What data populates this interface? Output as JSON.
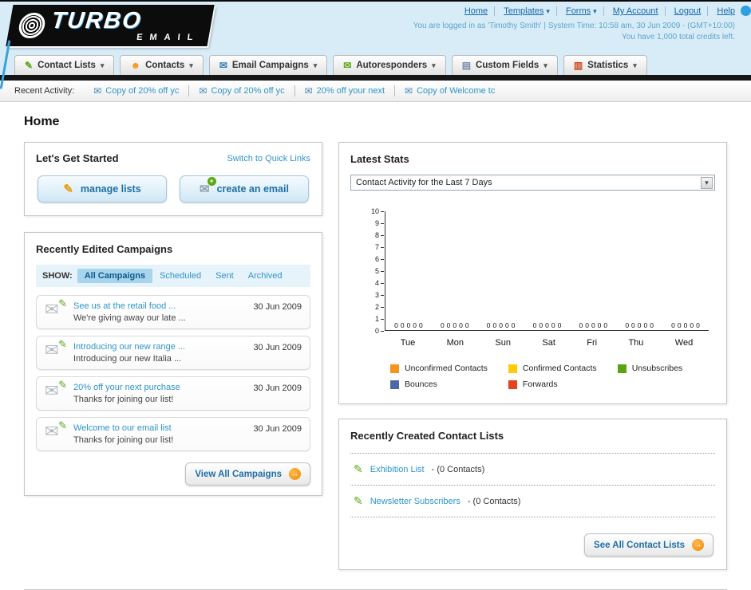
{
  "icons": {
    "dropdown_arrow": "▾",
    "envelope": "✉",
    "pencil": "✎",
    "arrow_right": "→",
    "plus": "+"
  },
  "header": {
    "brand_top": "TURBO",
    "brand_bottom": "EMAIL",
    "links": [
      {
        "label": "Home"
      },
      {
        "label": "Templates"
      },
      {
        "label": "Forms"
      },
      {
        "label": "My Account"
      },
      {
        "label": "Logout"
      },
      {
        "label": "Help"
      }
    ],
    "login_info": "You are logged in as 'Timothy Smith' | System Time: 10:58 am, 30 Jun 2009 - (GMT+10:00)",
    "credits": "You have 1,000 total credits left."
  },
  "nav": {
    "items": [
      {
        "label": "Contact Lists",
        "icon": "✎"
      },
      {
        "label": "Contacts",
        "icon": "☻"
      },
      {
        "label": "Email Campaigns",
        "icon": "✉"
      },
      {
        "label": "Autoresponders",
        "icon": "✉"
      },
      {
        "label": "Custom Fields",
        "icon": "▤"
      },
      {
        "label": "Statistics",
        "icon": "▥"
      }
    ]
  },
  "recent_activity": {
    "label": "Recent Activity:",
    "items": [
      "Copy of 20% off yc",
      "Copy of 20% off yc",
      "20% off your next",
      "Copy of Welcome tc"
    ]
  },
  "page": {
    "title": "Home"
  },
  "get_started": {
    "title": "Let's Get Started",
    "switch_link": "Switch to Quick Links",
    "manage_lists_label": "manage lists",
    "create_email_label": "create an email"
  },
  "campaigns": {
    "title": "Recently Edited Campaigns",
    "show_label": "SHOW:",
    "tabs": [
      "All Campaigns",
      "Scheduled",
      "Sent",
      "Archived"
    ],
    "active_tab": "All Campaigns",
    "items": [
      {
        "title": "See us at the retail food ...",
        "subtitle": "We're giving away our late ...",
        "date": "30 Jun 2009"
      },
      {
        "title": "Introducing our new range ...",
        "subtitle": "Introducing our new Italia ...",
        "date": "30 Jun 2009"
      },
      {
        "title": "20% off your next purchase",
        "subtitle": "Thanks for joining our list!",
        "date": "30 Jun 2009"
      },
      {
        "title": "Welcome to our email list",
        "subtitle": "Thanks for joining our list!",
        "date": "30 Jun 2009"
      }
    ],
    "view_all_label": "View All Campaigns"
  },
  "stats": {
    "title": "Latest Stats",
    "dropdown_value": "Contact Activity for the Last 7 Days",
    "chart_data": {
      "type": "bar",
      "title": "Contact Activity for the Last 7 Days",
      "categories": [
        "Tue",
        "Mon",
        "Sun",
        "Sat",
        "Fri",
        "Thu",
        "Wed"
      ],
      "series": [
        {
          "name": "Unconfirmed Contacts",
          "color": "#f7941d",
          "values": [
            0,
            0,
            0,
            0,
            0,
            0,
            0
          ]
        },
        {
          "name": "Confirmed Contacts",
          "color": "#ffcc00",
          "values": [
            0,
            0,
            0,
            0,
            0,
            0,
            0
          ]
        },
        {
          "name": "Unsubscribes",
          "color": "#5aa411",
          "values": [
            0,
            0,
            0,
            0,
            0,
            0,
            0
          ]
        },
        {
          "name": "Bounces",
          "color": "#4a69a5",
          "values": [
            0,
            0,
            0,
            0,
            0,
            0,
            0
          ]
        },
        {
          "name": "Forwards",
          "color": "#e5421d",
          "values": [
            0,
            0,
            0,
            0,
            0,
            0,
            0
          ]
        }
      ],
      "ylim": [
        0,
        10
      ],
      "grid": false,
      "legend_position": "bottom"
    }
  },
  "contact_lists": {
    "title": "Recently Created Contact Lists",
    "items": [
      {
        "name": "Exhibition List",
        "detail": "- (0 Contacts)"
      },
      {
        "name": "Newsletter Subscribers",
        "detail": "- (0 Contacts)"
      }
    ],
    "see_all_label": "See All Contact Lists"
  }
}
